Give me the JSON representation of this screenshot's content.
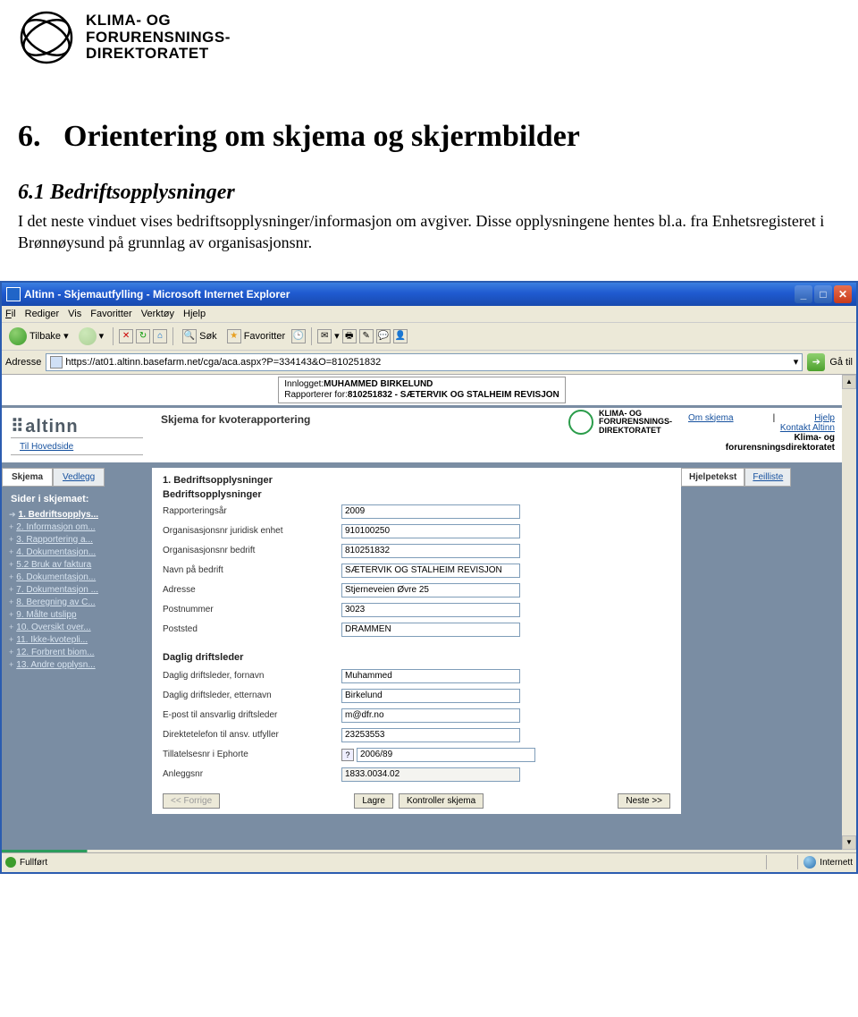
{
  "doc_header": {
    "org_line1": "KLIMA- OG",
    "org_line2": "FORURENSNINGS-",
    "org_line3": "DIREKTORATET"
  },
  "section": {
    "number": "6.",
    "title": "Orientering om skjema og skjermbilder"
  },
  "subsection": {
    "number": "6.1",
    "title": "Bedriftsopplysninger"
  },
  "bodytext": "I det neste vinduet vises bedriftsopplysninger/informasjon om avgiver. Disse opplysningene hentes bl.a. fra Enhetsregisteret i Brønnøysund på grunnlag av organisasjonsnr.",
  "browser": {
    "title": "Altinn - Skjemautfylling - Microsoft Internet Explorer",
    "menu": [
      "Fil",
      "Rediger",
      "Vis",
      "Favoritter",
      "Verktøy",
      "Hjelp"
    ],
    "toolbar": {
      "back": "Tilbake",
      "sok": "Søk",
      "fav": "Favoritter"
    },
    "address_label": "Adresse",
    "address": "https://at01.altinn.basefarm.net/cga/aca.aspx?P=334143&O=810251832",
    "go": "Gå til",
    "status": "Fullført",
    "status_right": "Internett"
  },
  "logged": {
    "line1_label": "Innlogget:",
    "line1_value": "MUHAMMED BIRKELUND",
    "line2_label": "Rapporterer for:",
    "line2_value": "810251832 - SÆTERVIK OG STALHEIM REVISJON"
  },
  "altinn": {
    "brand": "altinn",
    "form_title": "Skjema for kvoterapportering",
    "klif_text1": "KLIMA- OG",
    "klif_text2": "FORURENSNINGS-",
    "klif_text3": "DIREKTORATET",
    "right_links": {
      "om": "Om skjema",
      "hjelp": "Hjelp",
      "kontakt": "Kontakt Altinn",
      "sub1": "Klima- og",
      "sub2": "forurensningsdirektoratet"
    },
    "hovedside": "Til Hovedside"
  },
  "sidebar": {
    "tabs": [
      "Skjema",
      "Vedlegg"
    ],
    "heading": "Sider i skjemaet:",
    "items": [
      {
        "num": "1.",
        "label": "Bedriftsopplys...",
        "current": true
      },
      {
        "num": "2.",
        "label": "Informasjon om..."
      },
      {
        "num": "3.",
        "label": "Rapportering a..."
      },
      {
        "num": "4.",
        "label": "Dokumentasjon..."
      },
      {
        "num": "5.2",
        "label": "Bruk av faktura"
      },
      {
        "num": "6.",
        "label": "Dokumentasjon..."
      },
      {
        "num": "7.",
        "label": "Dokumentasjon ..."
      },
      {
        "num": "8.",
        "label": "Beregning av C..."
      },
      {
        "num": "9.",
        "label": "Målte utslipp"
      },
      {
        "num": "10.",
        "label": "Oversikt over..."
      },
      {
        "num": "11.",
        "label": "Ikke-kvotepli..."
      },
      {
        "num": "12.",
        "label": "Forbrent biom..."
      },
      {
        "num": "13.",
        "label": "Andre opplysn..."
      }
    ]
  },
  "rightpanel": {
    "tabs": [
      "Hjelpetekst",
      "Feilliste"
    ]
  },
  "form": {
    "section1_num": "1. Bedriftsopplysninger",
    "section1_head": "Bedriftsopplysninger",
    "rows1": [
      {
        "label": "Rapporteringsår",
        "value": "2009"
      },
      {
        "label": "Organisasjonsnr juridisk enhet",
        "value": "910100250"
      },
      {
        "label": "Organisasjonsnr bedrift",
        "value": "810251832"
      },
      {
        "label": "Navn på bedrift",
        "value": "SÆTERVIK OG STALHEIM REVISJON"
      },
      {
        "label": "Adresse",
        "value": "Stjerneveien Øvre 25"
      },
      {
        "label": "Postnummer",
        "value": "3023"
      },
      {
        "label": "Poststed",
        "value": "DRAMMEN"
      }
    ],
    "section2_head": "Daglig driftsleder",
    "rows2": [
      {
        "label": "Daglig driftsleder, fornavn",
        "value": "Muhammed"
      },
      {
        "label": "Daglig driftsleder, etternavn",
        "value": "Birkelund"
      },
      {
        "label": "E-post til ansvarlig driftsleder",
        "value": "m@dfr.no"
      },
      {
        "label": "Direktetelefon til ansv. utfyller",
        "value": "23253553"
      },
      {
        "label": "Tillatelsesnr i Ephorte",
        "value": "2006/89",
        "help": true
      },
      {
        "label": "Anleggsnr",
        "value": "1833.0034.02",
        "readonly": true
      }
    ],
    "buttons": {
      "prev": "<< Forrige",
      "save": "Lagre",
      "check": "Kontroller skjema",
      "next": "Neste >>"
    }
  }
}
